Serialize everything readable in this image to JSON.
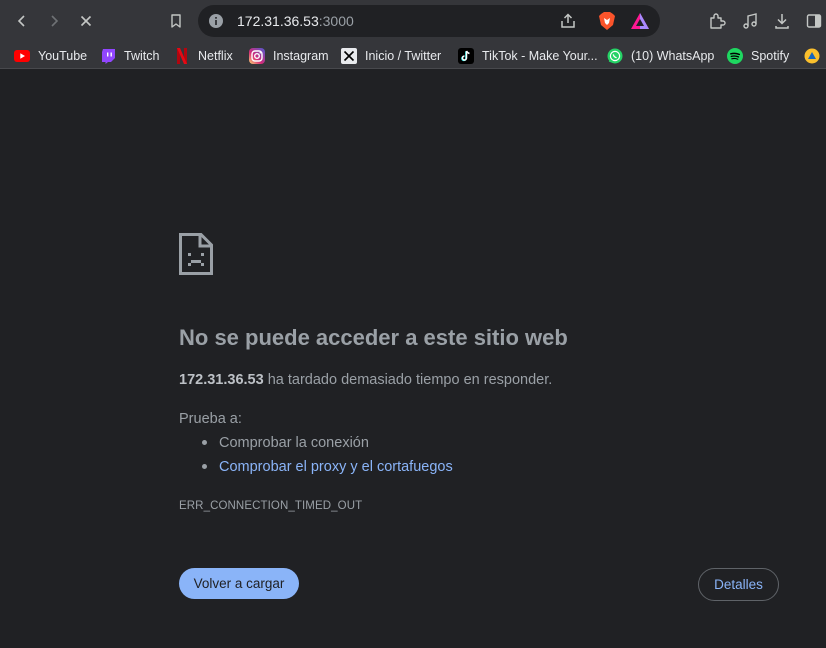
{
  "omnibox": {
    "host": "172.31.36.53",
    "port": ":3000"
  },
  "bookmarks": [
    {
      "label": "YouTube",
      "icon": "youtube-icon"
    },
    {
      "label": "Twitch",
      "icon": "twitch-icon"
    },
    {
      "label": "Netflix",
      "icon": "netflix-icon"
    },
    {
      "label": "Instagram",
      "icon": "instagram-icon"
    },
    {
      "label": "Inicio / Twitter",
      "icon": "x-twitter-icon"
    },
    {
      "label": "TikTok - Make Your...",
      "icon": "tiktok-icon"
    },
    {
      "label": "(10) WhatsApp",
      "icon": "whatsapp-icon"
    },
    {
      "label": "Spotify",
      "icon": "spotify-icon"
    }
  ],
  "error": {
    "heading": "No se puede acceder a este sitio web",
    "host": "172.31.36.53",
    "summary_rest": " ha tardado demasiado tiempo en responder.",
    "try_label": "Prueba a:",
    "suggestions": [
      "Comprobar la conexión",
      "Comprobar el proxy y el cortafuegos"
    ],
    "code": "ERR_CONNECTION_TIMED_OUT",
    "reload_label": "Volver a cargar",
    "details_label": "Detalles"
  },
  "colors": {
    "background": "#202124",
    "toolbar": "#35363a",
    "accent": "#8ab4f8",
    "text_muted": "#9aa0a6"
  }
}
